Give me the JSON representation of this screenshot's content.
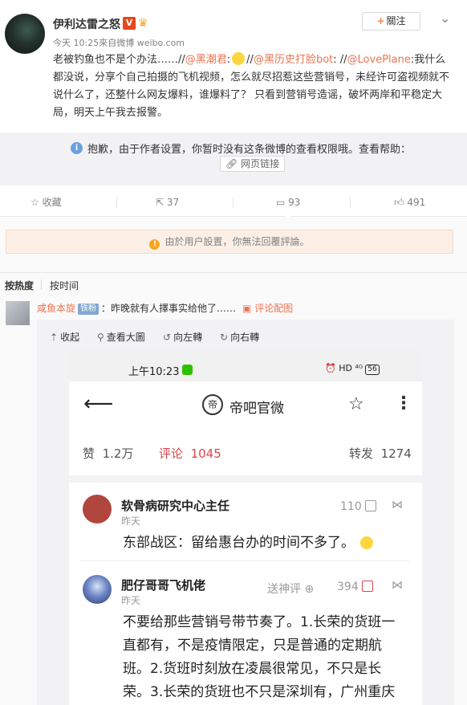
{
  "post": {
    "username": "伊利达雷之怒",
    "verified_badge": "V",
    "member_badge_icon": "crown-icon",
    "meta": "今天 10:25來自微博 weibo.com",
    "follow_label": "關注",
    "text_part1": "老被钓鱼也不是个办法……//",
    "mention1": "@黑潮君",
    "text_part2": ":",
    "text_part3": "//",
    "mention2": "@黑历史打脸bot",
    "text_part4": ": //",
    "mention3": "@LovePlane",
    "text_part5": ":我什么都没说，分享个自己拍摄的飞机视频，怎么就尽招惹这些营销号，未经许可盗视频就不说什么了，还整什么网友爆料，谁爆料了？ 只看到营销号造谣，破坏两岸和平稳定大局，明天上午我去报警。"
  },
  "retweet_notice": {
    "text": "抱歉，由于作者设置，你暂时没有这条微博的查看权限哦。查看帮助：",
    "link_label": "网页链接"
  },
  "actions": {
    "favorite_label": "收藏",
    "repost_count": "37",
    "comment_count": "93",
    "like_count": "491"
  },
  "comments": {
    "notice": "由於用户設置，你無法回覆評論。",
    "sort_hot": "按热度",
    "sort_time": "按时间",
    "first": {
      "user": "咸鱼本旋",
      "badge": "铁粉",
      "text": "：昨晚就有人擇事实给他了……",
      "pic_label": "评论配图"
    }
  },
  "viewer": {
    "collapse": "收起",
    "view_large": "查看大圖",
    "rotate_left": "向左轉",
    "rotate_right": "向右轉"
  },
  "screenshot": {
    "time": "上午10:23",
    "status_icons": "⏰ HD ⁴ᴳ",
    "battery": "56",
    "page_title": "帝吧官微",
    "logo_char": "帝",
    "tab_like_label": "赞",
    "tab_like_count": "1.2万",
    "tab_comment_label": "评论",
    "tab_comment_count": "1045",
    "tab_repost_label": "转发",
    "tab_repost_count": "1274",
    "c1_name": "软骨病研究中心主任",
    "c1_time": "昨天",
    "c1_likes": "110",
    "c1_text": "东部战区：留给惠台办的时间不多了。",
    "c2_name": "肥仔哥哥飞机佬",
    "c2_time": "昨天",
    "c2_action": "送神评",
    "c2_likes": "394",
    "c2_text_l1": "不要给那些营销号带节奏了。1.长荣的货班一",
    "c2_text_l2": "直都有，不是疫情限定，只是普通的定期航",
    "c2_text_l3": "班。2.货班时刻放在凌晨很常见，不只是长",
    "c2_text_l4": "荣。3.长荣的货班也不只是深圳有，广州重庆"
  },
  "colors": {
    "link": "#eb7350",
    "accent_red": "#d9464a",
    "notice_bg": "#fcf0e6"
  }
}
